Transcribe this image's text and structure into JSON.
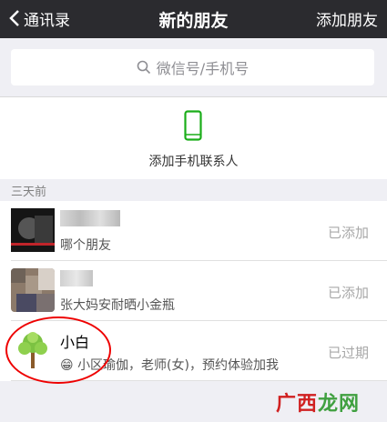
{
  "nav": {
    "back_label": "通讯录",
    "title": "新的朋友",
    "action_label": "添加朋友"
  },
  "search": {
    "placeholder": "微信号/手机号"
  },
  "phone_contacts": {
    "label": "添加手机联系人",
    "icon": "phone-icon",
    "icon_color": "#1aad19"
  },
  "group": {
    "header": "三天前"
  },
  "requests": [
    {
      "name": "",
      "message": "哪个朋友",
      "status": "已添加"
    },
    {
      "name": "",
      "message": "张大妈安耐晒小金瓶",
      "status": "已添加"
    },
    {
      "name": "小白",
      "message": "小区瑜伽，老师(女)，预约体验加我",
      "status": "已过期",
      "emoji": "😁"
    }
  ],
  "watermark": {
    "text_a": "广西",
    "text_b": "龙网"
  },
  "colors": {
    "nav_bg": "#2b2b2f",
    "accent_green": "#1aad19",
    "highlight_circle": "#ee0000"
  }
}
